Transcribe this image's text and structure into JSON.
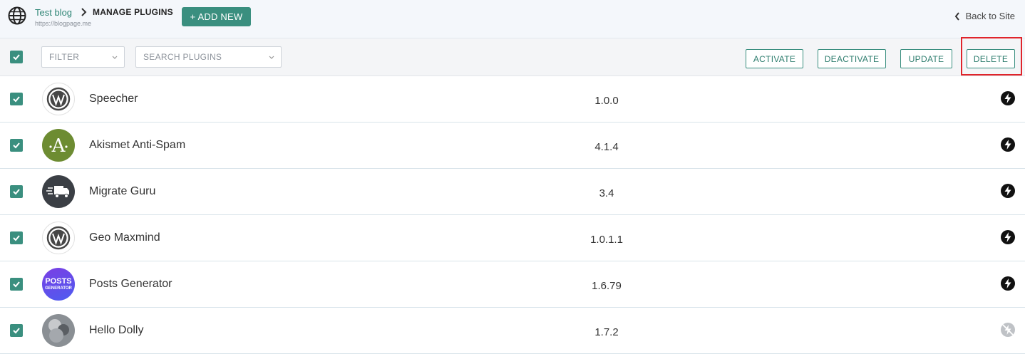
{
  "header": {
    "site_name": "Test blog",
    "site_url": "https://blogpage.me",
    "page_title": "MANAGE PLUGINS",
    "add_new_label": "+ ADD NEW",
    "back_label": "Back to Site"
  },
  "toolbar": {
    "filter_placeholder": "FILTER",
    "search_placeholder": "SEARCH PLUGINS",
    "activate_label": "ACTIVATE",
    "deactivate_label": "DEACTIVATE",
    "update_label": "UPDATE",
    "delete_label": "DELETE"
  },
  "plugins": [
    {
      "name": "Speecher",
      "version": "1.0.0",
      "logo": "wordpress-logo",
      "active": true,
      "checked": true
    },
    {
      "name": "Akismet Anti-Spam",
      "version": "4.1.4",
      "logo": "akismet-logo",
      "active": true,
      "checked": true
    },
    {
      "name": "Migrate Guru",
      "version": "3.4",
      "logo": "migrate-guru-logo",
      "active": true,
      "checked": true
    },
    {
      "name": "Geo Maxmind",
      "version": "1.0.1.1",
      "logo": "wordpress-logo",
      "active": true,
      "checked": true
    },
    {
      "name": "Posts Generator",
      "version": "1.6.79",
      "logo": "posts-generator-logo",
      "logo_text": [
        "POSTS",
        "GENERATOR"
      ],
      "active": true,
      "checked": true
    },
    {
      "name": "Hello Dolly",
      "version": "1.7.2",
      "logo": "hello-dolly-logo",
      "active": false,
      "checked": true
    }
  ],
  "colors": {
    "accent": "#3a8f7f",
    "highlight": "#e0242b"
  }
}
